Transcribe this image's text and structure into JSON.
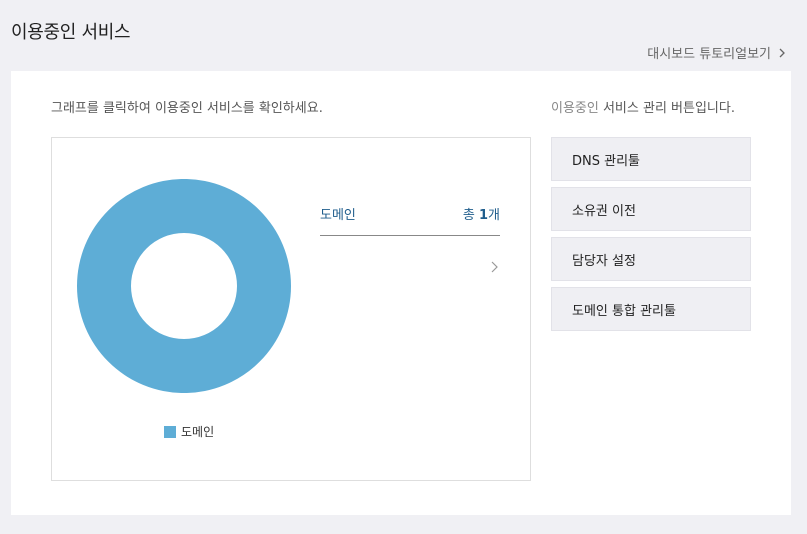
{
  "header": {
    "title": "이용중인 서비스",
    "tutorial_link": "대시보드 튜토리얼보기"
  },
  "card": {
    "guide_text": "그래프를 클릭하여 이용중인 서비스를 확인하세요.",
    "button_guide_prefix": "이용중인",
    "button_guide_suffix": " 서비스 관리 버튼입니다."
  },
  "chart_data": {
    "type": "pie",
    "categories": [
      "도메인"
    ],
    "values": [
      1
    ],
    "colors": [
      "#5eadd6"
    ],
    "legend": [
      "도메인"
    ],
    "legend_position": "bottom"
  },
  "summary": {
    "label": "도메인",
    "count_prefix": "총 ",
    "count_value": "1",
    "count_suffix": "개"
  },
  "service_buttons": [
    {
      "label": "DNS 관리툴"
    },
    {
      "label": "소유권 이전"
    },
    {
      "label": "담당자 설정"
    },
    {
      "label": "도메인 통합 관리툴"
    }
  ]
}
